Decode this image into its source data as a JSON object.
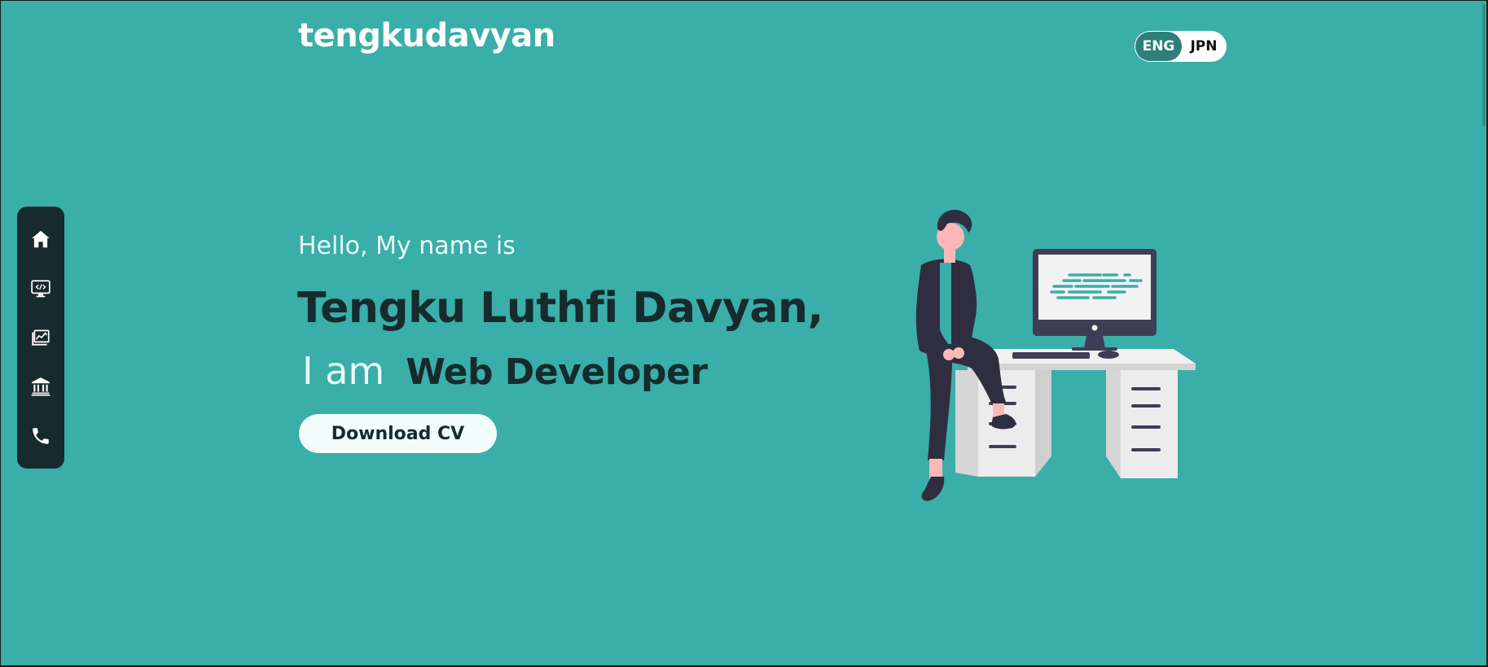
{
  "header": {
    "brand": "tengkudavyan",
    "languages": [
      {
        "label": "ENG",
        "active": true
      },
      {
        "label": "JPN",
        "active": false
      }
    ]
  },
  "side_nav": {
    "items": [
      {
        "icon": "home-icon",
        "name": "home"
      },
      {
        "icon": "code-monitor-icon",
        "name": "skills"
      },
      {
        "icon": "chart-icon",
        "name": "portfolio"
      },
      {
        "icon": "bank-icon",
        "name": "education"
      },
      {
        "icon": "phone-icon",
        "name": "contact"
      }
    ]
  },
  "hero": {
    "greeting": "Hello, My name is",
    "name": "Tengku Luthfi Davyan,",
    "role_prefix": "I am",
    "role": "Web Developer",
    "cv_button": "Download CV"
  },
  "colors": {
    "background": "#3aaea8",
    "dark": "#172a2d",
    "accent": "#2e7f7a",
    "light": "#f2fcfb"
  }
}
